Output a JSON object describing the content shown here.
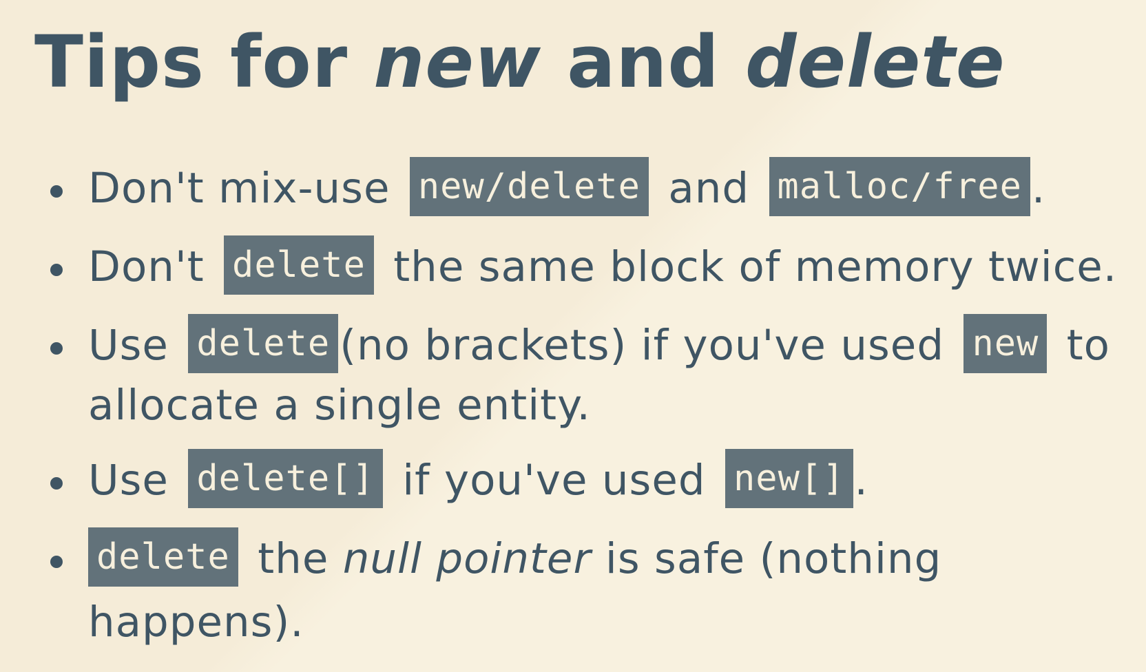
{
  "slide": {
    "title_prefix": "Tips for ",
    "title_new": "new",
    "title_mid": " and ",
    "title_delete": "delete"
  },
  "bullets": [
    {
      "t1": "Don't mix-use ",
      "c1": "new/delete",
      "t2": " and ",
      "c2": "malloc/free",
      "t3": "."
    },
    {
      "t1": "Don't ",
      "c1": "delete",
      "t2": " the same block of memory twice."
    },
    {
      "t1": "Use ",
      "c1": "delete",
      "t2": "(no brackets) if you've used ",
      "c2": "new",
      "t3": " to",
      "t4": "allocate a single entity."
    },
    {
      "t1": "Use ",
      "c1": "delete[]",
      "t2": " if you've used ",
      "c2": "new[]",
      "t3": "."
    },
    {
      "c1": "delete",
      "t1": " the ",
      "i1": "null pointer",
      "t2": " is safe (nothing happens)."
    }
  ],
  "colors": {
    "background": "#f5ecd8",
    "text": "#3f5564",
    "code_background": "#62727a",
    "code_text": "#f7f0dd"
  }
}
